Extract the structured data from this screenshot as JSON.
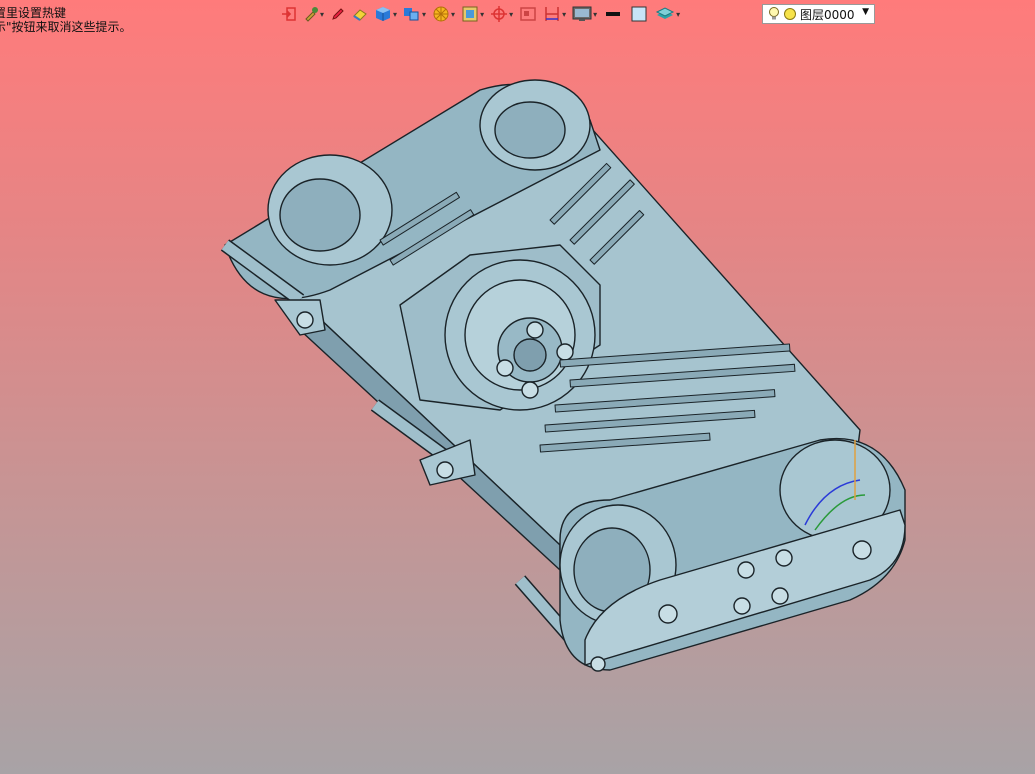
{
  "hint": {
    "line1": "置里设置热键",
    "line2": "示\"按钮来取消这些提示。"
  },
  "toolbar": {
    "icons": [
      "exit-icon",
      "pipette-icon",
      "pencil-icon",
      "eraser-icon",
      "cube-icon",
      "view-cube-icon",
      "wheel-icon",
      "frame-icon",
      "target-icon",
      "rectangle-icon",
      "dimension-icon",
      "monitor-icon",
      "line-color-icon",
      "fill-color-icon",
      "layer-stack-icon"
    ],
    "layer_select": {
      "value": "图层0000"
    }
  },
  "colors": {
    "model": "#9fbfcb",
    "model_dark": "#7f9fae",
    "model_light": "#c3dbe3",
    "outline": "#1a2328"
  }
}
